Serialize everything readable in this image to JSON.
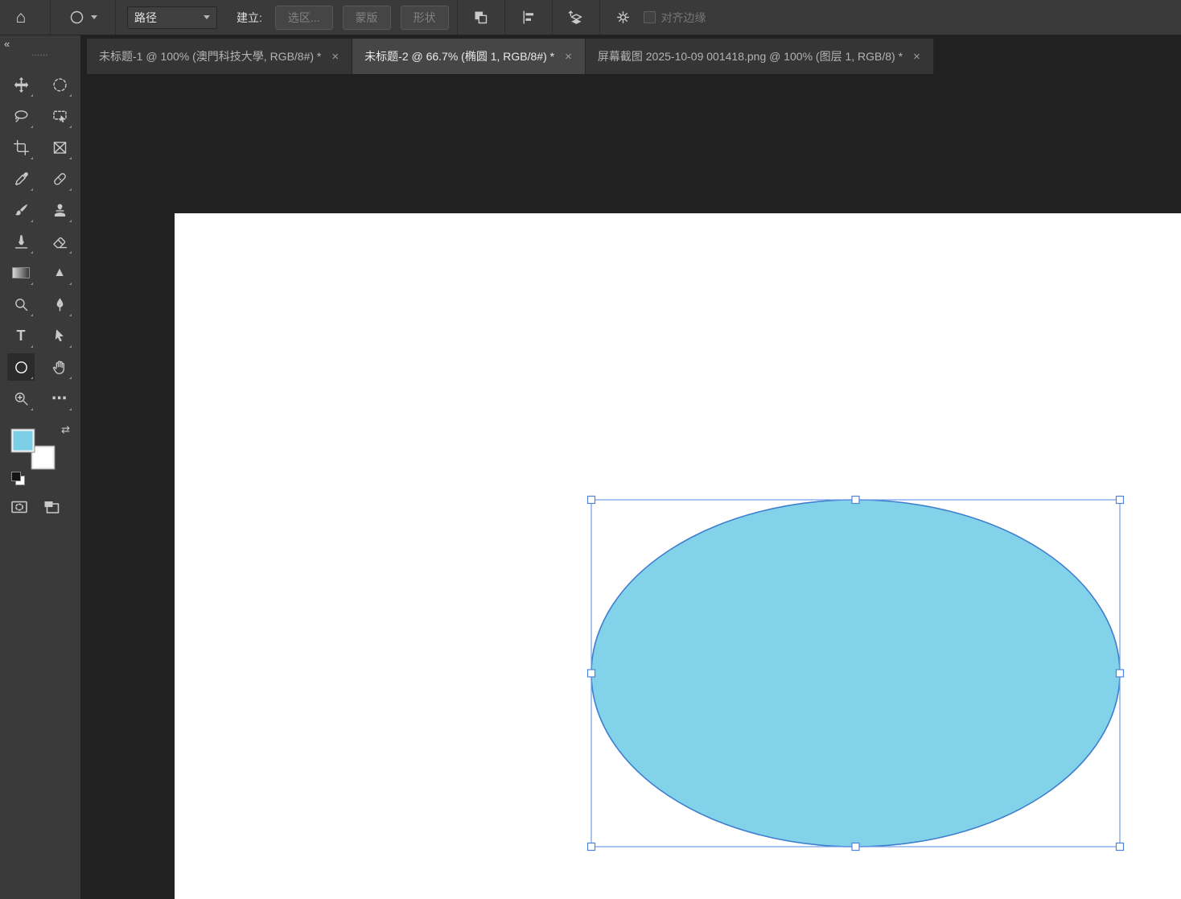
{
  "options_bar": {
    "mode": "路径",
    "create_label": "建立:",
    "make_selection": "选区...",
    "mask": "蒙版",
    "shape": "形状",
    "align_edges": "对齐边缘"
  },
  "tabs": [
    {
      "title": "未标题-1 @ 100% (澳門科技大學, RGB/8#) *",
      "close": "×",
      "active": false
    },
    {
      "title": "未标题-2 @ 66.7% (椭圆 1, RGB/8#) *",
      "close": "×",
      "active": true
    },
    {
      "title": "屏幕截图 2025-10-09 001418.png @ 100% (图层 1, RGB/8) *",
      "close": "×",
      "active": false
    }
  ],
  "sidebar": {
    "collapse": "«",
    "grip": "••••••"
  },
  "icons": {
    "home": "⌂",
    "frame": "⊠",
    "sharpen": "▲",
    "type": "T",
    "more": "⋯",
    "swap": "⇄"
  },
  "canvas": {
    "zoom_percent": "66.7%",
    "fill": "#82d2e9",
    "stroke": "#3e7ecf",
    "selection_box": "#6f9de8",
    "handle_border": "#4d84d8",
    "background": "#ffffff"
  },
  "swatches": {
    "foreground": "#7bcfe6",
    "background": "#ffffff"
  }
}
